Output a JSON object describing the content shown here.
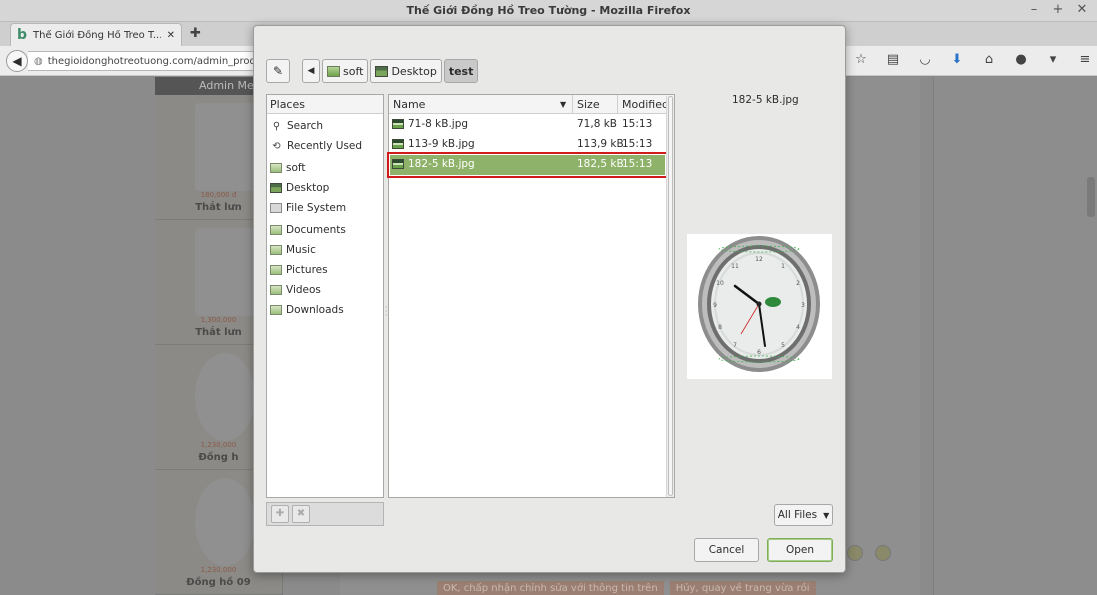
{
  "window": {
    "title": "Thế Giới Đồng Hồ Treo Tường - Mozilla Firefox",
    "controls": [
      "–",
      "+",
      "✕"
    ]
  },
  "browser": {
    "tab": {
      "favicon": "b",
      "label": "Thế Giới Đồng Hồ Treo T...",
      "close": "✕"
    },
    "new_tab": "✚",
    "url": "thegioidonghotreotuong.com/admin_produc",
    "nav_icons": [
      "star-icon",
      "reading-list-icon",
      "pocket-icon",
      "download-icon",
      "home-icon",
      "chat-icon",
      "extension-icon",
      "menu-icon"
    ]
  },
  "background_page": {
    "admin_header": "Admin Me",
    "products": [
      {
        "price": "180,000 đ",
        "name": "Thắt lưn"
      },
      {
        "price": "1,300,000",
        "name": "Thắt lưn"
      },
      {
        "price": "1,230,000",
        "name": "Đồng h"
      },
      {
        "price": "1,230,000",
        "name": "Đồng hồ 09"
      }
    ],
    "buttons": [
      "OK, chấp nhận chỉnh sửa với thông tin trên",
      "Hủy, quay về trang vừa rồi"
    ]
  },
  "dialog": {
    "path": {
      "back_arrow": "◀",
      "crumbs": [
        "soft",
        "Desktop",
        "test"
      ],
      "current": "test"
    },
    "places": {
      "header": "Places",
      "items": [
        {
          "label": "Search",
          "icon": "search-icon",
          "glyph": "🔍"
        },
        {
          "label": "Recently Used",
          "icon": "clock-icon",
          "glyph": "⟲"
        },
        {
          "label": "soft",
          "icon": "folder-icon"
        },
        {
          "label": "Desktop",
          "icon": "desktop-icon"
        },
        {
          "label": "File System",
          "icon": "drive-icon"
        },
        {
          "label": "Documents",
          "icon": "folder-icon"
        },
        {
          "label": "Music",
          "icon": "folder-icon"
        },
        {
          "label": "Pictures",
          "icon": "folder-icon"
        },
        {
          "label": "Videos",
          "icon": "folder-icon"
        },
        {
          "label": "Downloads",
          "icon": "folder-icon"
        }
      ],
      "add_button": "✚",
      "remove_button": "✖"
    },
    "files": {
      "columns": {
        "name": "Name",
        "size": "Size",
        "modified": "Modified",
        "sort_glyph": "▼"
      },
      "rows": [
        {
          "name": "71-8 kB.jpg",
          "size": "71,8 kB",
          "modified": "15:13",
          "selected": false
        },
        {
          "name": "113-9 kB.jpg",
          "size": "113,9 kB",
          "modified": "15:13",
          "selected": false
        },
        {
          "name": "182-5 kB.jpg",
          "size": "182,5 kB",
          "modified": "15:13",
          "selected": true
        }
      ]
    },
    "preview": {
      "filename": "182-5 kB.jpg"
    },
    "filter": {
      "value": "All Files",
      "caret": "▼"
    },
    "buttons": {
      "cancel": "Cancel",
      "open": "Open"
    }
  },
  "colors": {
    "selection": "#8fb26a",
    "highlight_outline": "#d11a1a",
    "open_border": "#7fae5a"
  }
}
